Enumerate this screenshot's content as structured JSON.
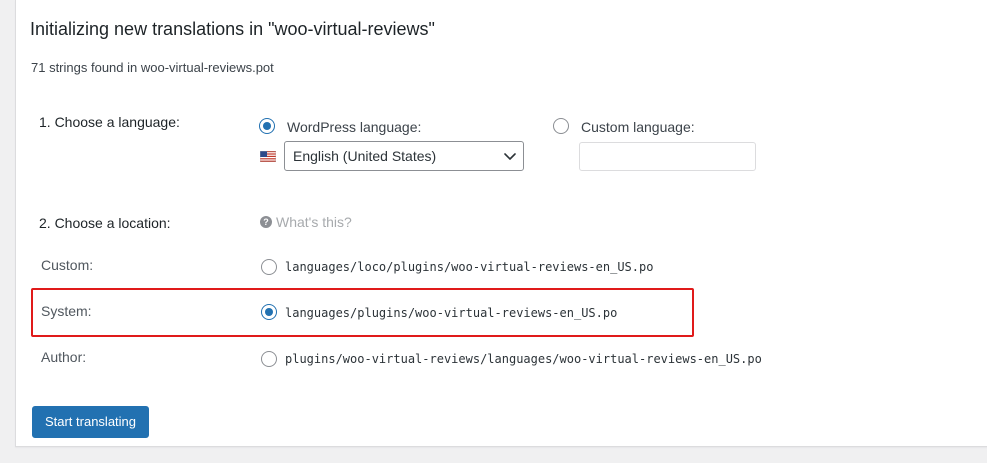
{
  "page": {
    "title": "Initializing new translations in \"woo-virtual-reviews\"",
    "subtitle": "71 strings found in woo-virtual-reviews.pot"
  },
  "language": {
    "heading": "1. Choose a language:",
    "wordpress_label": "WordPress language:",
    "custom_label": "Custom language:",
    "selected_option": "English (United States)",
    "custom_value": "",
    "selected_mode": "wordpress"
  },
  "location": {
    "heading": "2. Choose a location:",
    "help_text": "What's this?",
    "options": [
      {
        "label": "Custom:",
        "path": "languages/loco/plugins/woo-virtual-reviews-en_US.po",
        "checked": false
      },
      {
        "label": "System:",
        "path": "languages/plugins/woo-virtual-reviews-en_US.po",
        "checked": true
      },
      {
        "label": "Author:",
        "path": "plugins/woo-virtual-reviews/languages/woo-virtual-reviews-en_US.po",
        "checked": false
      }
    ]
  },
  "actions": {
    "start_label": "Start translating"
  },
  "colors": {
    "accent": "#2271b1",
    "highlight": "#e01a1a"
  },
  "icons": {
    "flag": "us-flag-icon",
    "help": "help-icon",
    "dropdown": "chevron-down-icon"
  }
}
